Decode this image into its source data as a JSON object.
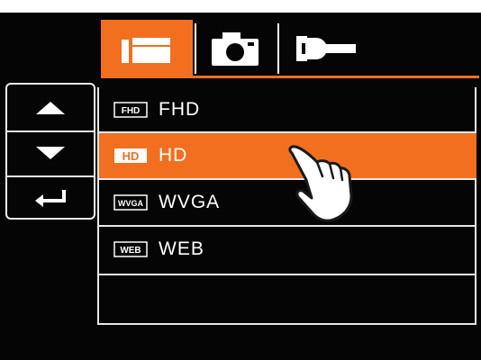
{
  "tabs": [
    {
      "id": "video",
      "icon": "video-mode-icon",
      "active": true
    },
    {
      "id": "photo",
      "icon": "camera-icon",
      "active": false
    },
    {
      "id": "setup",
      "icon": "wrench-icon",
      "active": false
    }
  ],
  "nav": {
    "up_icon": "triangle-up-icon",
    "down_icon": "triangle-down-icon",
    "back_icon": "return-arrow-icon"
  },
  "menu": {
    "items": [
      {
        "label": "FHD",
        "icon_text": "FHD",
        "selected": false
      },
      {
        "label": "HD",
        "icon_text": "HD",
        "selected": true
      },
      {
        "label": "WVGA",
        "icon_text": "WVGA",
        "selected": false
      },
      {
        "label": "WEB",
        "icon_text": "WEB",
        "selected": false
      },
      {
        "label": "",
        "icon_text": "",
        "selected": false
      }
    ]
  },
  "colors": {
    "accent": "#f26f1f",
    "background": "#050505",
    "foreground": "#ffffff"
  },
  "pointer_icon": "hand-pointer-icon"
}
